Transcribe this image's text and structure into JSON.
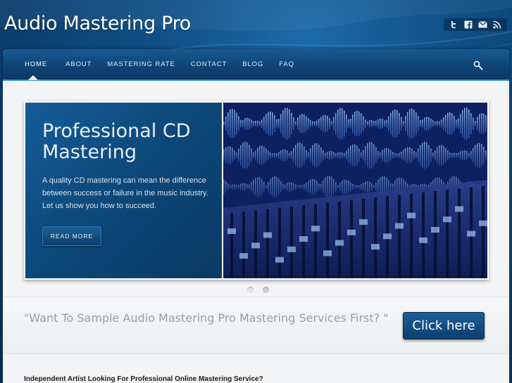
{
  "site": {
    "title": "Audio Mastering Pro"
  },
  "social": [
    {
      "icon": "twitter-icon"
    },
    {
      "icon": "facebook-icon"
    },
    {
      "icon": "email-icon"
    },
    {
      "icon": "rss-icon"
    }
  ],
  "nav": {
    "items": [
      {
        "label": "HOME",
        "active": true
      },
      {
        "label": "ABOUT"
      },
      {
        "label": "MASTERING RATE"
      },
      {
        "label": "CONTACT"
      },
      {
        "label": "BLOG"
      },
      {
        "label": "FAQ"
      }
    ],
    "search_icon": "search-icon"
  },
  "slider": {
    "title": "Professional CD Mastering",
    "description": "A quality CD mastering can mean the difference between success or failure in the music industry. Let us show you how to succeed.",
    "read_more_label": "READ MORE",
    "image": "waveform-mixing-console-image",
    "dots": 2
  },
  "cta": {
    "text": "\"Want To Sample Audio Mastering Pro Mastering Services First? \"",
    "button_label": "Click here"
  },
  "content": {
    "heading": "Independent Artist Looking For Professional Online Mastering Service?"
  },
  "colors": {
    "brand_blue": "#0e4475",
    "accent": "#2b8bd4",
    "page_bg": "#f3f4f6"
  }
}
